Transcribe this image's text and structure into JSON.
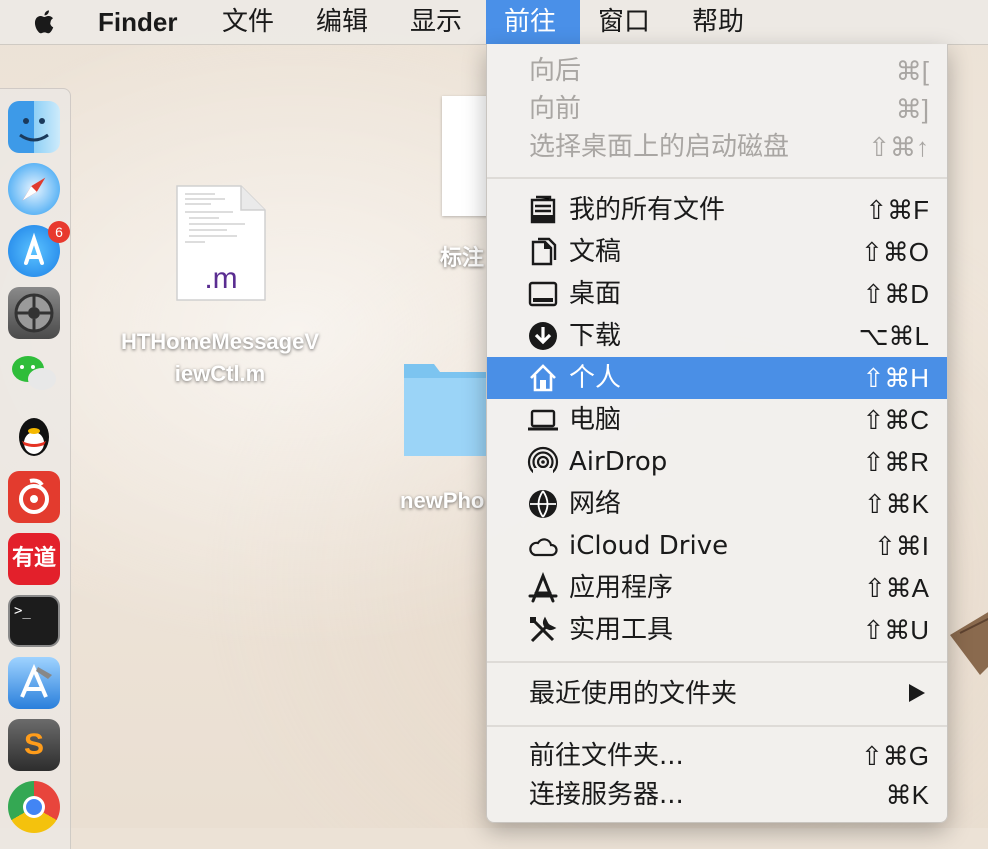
{
  "menubar": {
    "app": "Finder",
    "items": [
      "文件",
      "编辑",
      "显示",
      "前往",
      "窗口",
      "帮助"
    ],
    "active_index": 3
  },
  "dock": {
    "appstore_badge": "6",
    "youdao_label": "有道",
    "terminal_prompt": ">_",
    "sublime_letter": "S"
  },
  "desktop": {
    "file_ext": ".m",
    "file_name_line1": "HTHomeMessageV",
    "file_name_line2": "iewCtl.m",
    "doc2_label": "标注",
    "folder_label": "newPho"
  },
  "go_menu": {
    "items": [
      {
        "label": "向后",
        "shortcut": "⌘[",
        "disabled": true
      },
      {
        "label": "向前",
        "shortcut": "⌘]",
        "disabled": true
      },
      {
        "label": "选择桌面上的启动磁盘",
        "shortcut": "⇧⌘↑",
        "disabled": true
      },
      {
        "label": "我的所有文件",
        "shortcut": "⇧⌘F",
        "icon": "all-files-icon"
      },
      {
        "label": "文稿",
        "shortcut": "⇧⌘O",
        "icon": "documents-icon"
      },
      {
        "label": "桌面",
        "shortcut": "⇧⌘D",
        "icon": "desktop-icon"
      },
      {
        "label": "下载",
        "shortcut": "⌥⌘L",
        "icon": "downloads-icon"
      },
      {
        "label": "个人",
        "shortcut": "⇧⌘H",
        "icon": "home-icon",
        "highlighted": true
      },
      {
        "label": "电脑",
        "shortcut": "⇧⌘C",
        "icon": "computer-icon"
      },
      {
        "label": "AirDrop",
        "shortcut": "⇧⌘R",
        "icon": "airdrop-icon"
      },
      {
        "label": "网络",
        "shortcut": "⇧⌘K",
        "icon": "network-icon"
      },
      {
        "label": "iCloud Drive",
        "shortcut": "⇧⌘I",
        "icon": "icloud-icon"
      },
      {
        "label": "应用程序",
        "shortcut": "⇧⌘A",
        "icon": "applications-icon"
      },
      {
        "label": "实用工具",
        "shortcut": "⇧⌘U",
        "icon": "utilities-icon"
      },
      {
        "label": "最近使用的文件夹",
        "submenu": true
      },
      {
        "label": "前往文件夹...",
        "shortcut": "⇧⌘G"
      },
      {
        "label": "连接服务器...",
        "shortcut": "⌘K"
      }
    ]
  },
  "colors": {
    "highlight": "#4a8fe6",
    "menu_bg": "#f2f0ee",
    "disabled_text": "#a9a6a3"
  }
}
